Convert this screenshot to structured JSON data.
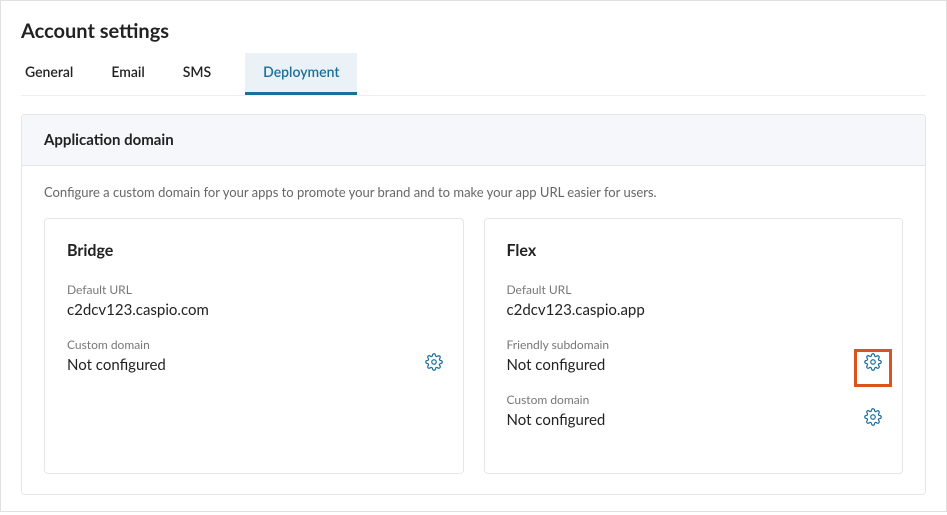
{
  "header": {
    "title": "Account settings"
  },
  "tabs": [
    {
      "label": "General",
      "active": false
    },
    {
      "label": "Email",
      "active": false
    },
    {
      "label": "SMS",
      "active": false
    },
    {
      "label": "Deployment",
      "active": true
    }
  ],
  "panel": {
    "title": "Application domain",
    "description": "Configure a custom domain for your apps to promote your brand and to make your app URL easier for users."
  },
  "bridge": {
    "title": "Bridge",
    "default_url_label": "Default URL",
    "default_url_value": "c2dcv123.caspio.com",
    "custom_domain_label": "Custom domain",
    "custom_domain_value": "Not configured"
  },
  "flex": {
    "title": "Flex",
    "default_url_label": "Default URL",
    "default_url_value": "c2dcv123.caspio.app",
    "friendly_subdomain_label": "Friendly subdomain",
    "friendly_subdomain_value": "Not configured",
    "custom_domain_label": "Custom domain",
    "custom_domain_value": "Not configured"
  }
}
